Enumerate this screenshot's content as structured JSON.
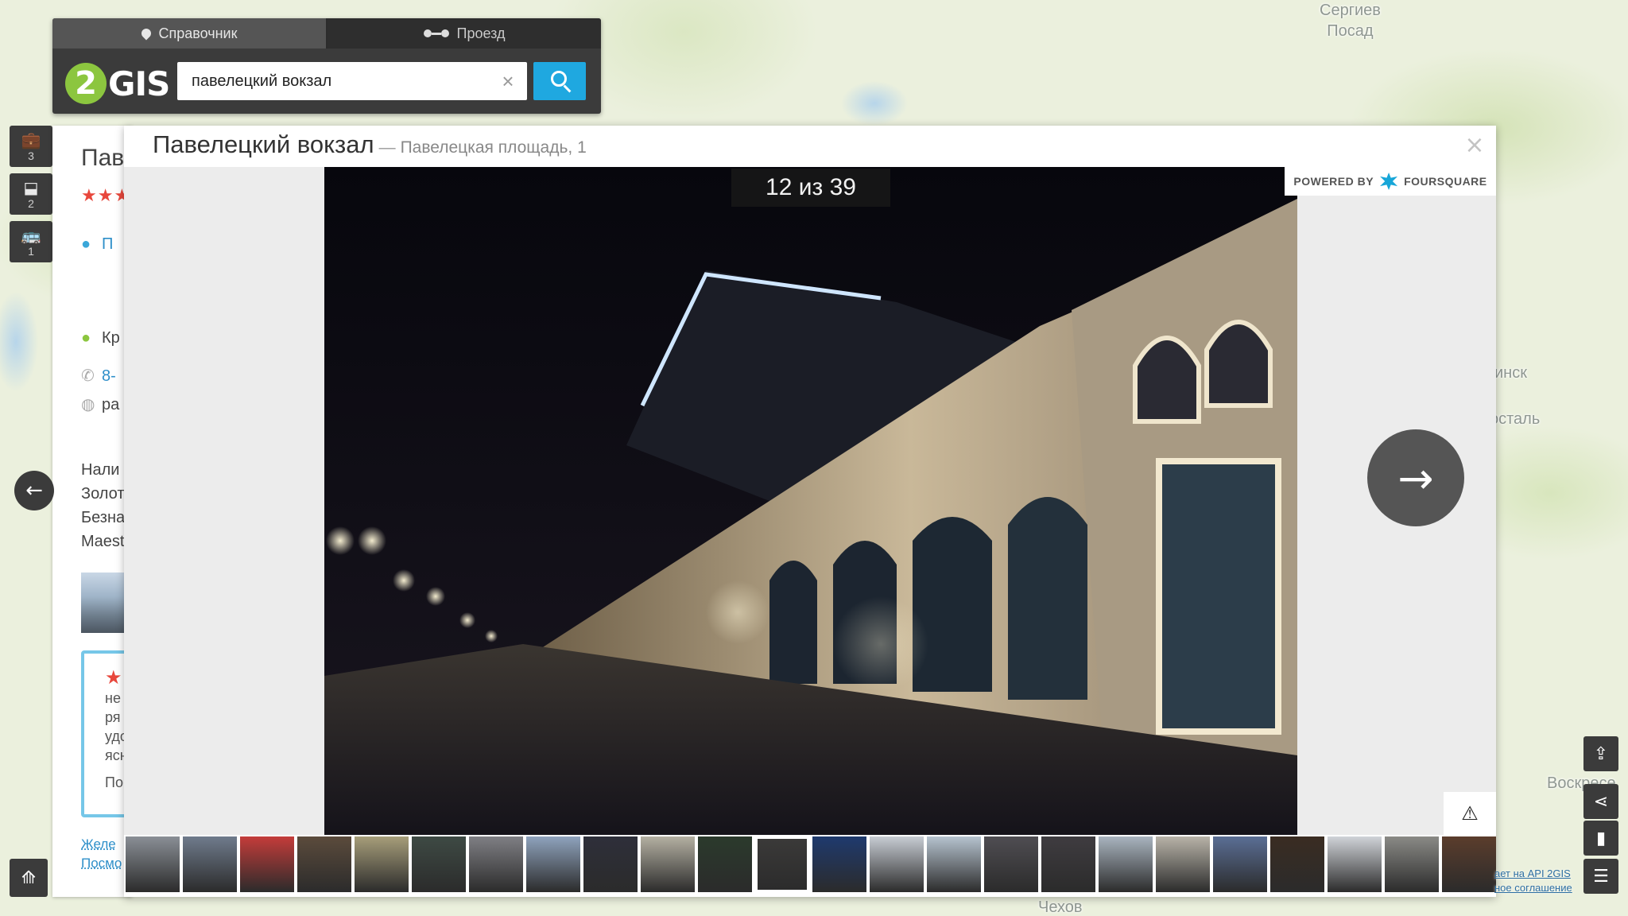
{
  "map": {
    "labels": [
      {
        "id": "sergiev",
        "text": "Сергиев\nПосад"
      },
      {
        "id": "minsk",
        "text": "инск"
      },
      {
        "id": "rostal",
        "text": "осталь"
      },
      {
        "id": "voskres",
        "text": "Воскресе"
      },
      {
        "id": "chekhov",
        "text": "Чехов"
      }
    ]
  },
  "search": {
    "tabs": [
      {
        "label": "Справочник",
        "icon": "pin-icon",
        "active": true
      },
      {
        "label": "Проезд",
        "icon": "route-icon",
        "active": false
      }
    ],
    "logo_digit": "2",
    "logo_text": "GIS",
    "query": "павелецкий вокзал",
    "clear_glyph": "×",
    "accent_color": "#1fa8e0"
  },
  "left_tools": [
    {
      "icon": "briefcase-icon",
      "glyph": "💼",
      "count": "3"
    },
    {
      "icon": "stamp-icon",
      "glyph": "⬓",
      "count": "2"
    },
    {
      "icon": "bus-icon",
      "glyph": "🚌",
      "count": "1"
    }
  ],
  "card": {
    "title": "Паве",
    "stars": "★★★",
    "address_link": "П",
    "hours": "Кр",
    "phone": "8-",
    "site": "ра",
    "payments": [
      "Нали",
      "Золот",
      "Безна",
      "Maest"
    ],
    "review_lines": [
      "не",
      "ря",
      "удо",
      "ясн"
    ],
    "review_more": "По",
    "link_1": "Желе",
    "link_2": "Посмо"
  },
  "gallery": {
    "title": "Павелецкий вокзал",
    "dash": "—",
    "subtitle": "Павелецкая площадь, 1",
    "close_glyph": "×",
    "counter": "12 из 39",
    "current_index": 12,
    "total": 39,
    "powered_by": "POWERED BY",
    "provider": "FOURSQUARE",
    "next_glyph": "→",
    "report_glyph": "⚠",
    "thumbnails": [
      "#8a8f96",
      "#6f7b8c",
      "#c43c3a",
      "#5b4b3c",
      "#a79e7a",
      "#3e4a44",
      "#7f7f84",
      "#8fa3bd",
      "#2e2f3a",
      "#b4b0a2",
      "#2b3a2c",
      "#3b3a39",
      "#1f3a6e",
      "#c7ccd3",
      "#b6c3cf",
      "#4f4d52",
      "#3f3c40",
      "#a9b4bf",
      "#b8b3a8",
      "#5a6e95",
      "#3a2c22",
      "#d0d3d8",
      "#8a8a86",
      "#5b3d2c"
    ]
  },
  "right_tools": [
    {
      "icon": "upload-cloud-icon",
      "glyph": "⇪"
    },
    {
      "icon": "share-icon",
      "glyph": "⋖"
    },
    {
      "icon": "comment-icon",
      "glyph": "▮"
    },
    {
      "icon": "menu-icon",
      "glyph": "☰"
    }
  ],
  "footer": {
    "api_link": "ает на API 2GIS",
    "agreement_link": "ное соглашение"
  }
}
